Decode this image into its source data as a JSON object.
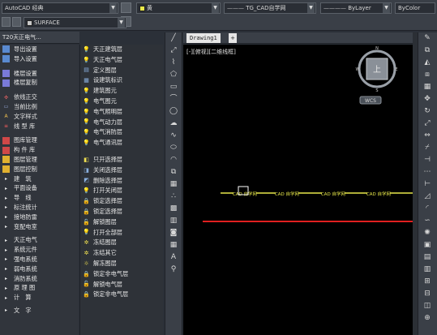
{
  "toolbar": {
    "workspace": "AutoCAD 经典",
    "layer": "黄",
    "linetype": "TG_CAD自学网",
    "lineweight": "ByLayer",
    "color": "ByColor",
    "visual_style": "SURFACE"
  },
  "panel": {
    "title": "T20天正电气..."
  },
  "menu_left": [
    {
      "label": "导出设置",
      "icon": "export-icon"
    },
    {
      "label": "导入设置",
      "icon": "import-icon"
    },
    {
      "label": "楼层设置",
      "icon": "floor-icon"
    },
    {
      "label": "楼层复制",
      "icon": "floor-copy-icon"
    },
    {
      "label": "依线正交",
      "icon": "ortho-icon"
    },
    {
      "label": "当前比例",
      "icon": "scale-icon"
    },
    {
      "label": "文字样式",
      "icon": "text-style-icon"
    },
    {
      "label": "线 型 库",
      "icon": "linetype-icon"
    },
    {
      "label": "图库管理",
      "icon": "library-icon"
    },
    {
      "label": "构 件 库",
      "icon": "component-icon"
    },
    {
      "label": "图层管理",
      "icon": "layer-manage-icon"
    },
    {
      "label": "图层控制",
      "icon": "layer-control-icon"
    },
    {
      "label": "建　筑",
      "icon": "arrow-icon"
    },
    {
      "label": "平面设备",
      "icon": "arrow-icon"
    },
    {
      "label": "导　线",
      "icon": "arrow-icon"
    },
    {
      "label": "标注统计",
      "icon": "arrow-icon"
    },
    {
      "label": "接地防雷",
      "icon": "arrow-icon"
    },
    {
      "label": "变配电室",
      "icon": "arrow-icon"
    },
    {
      "label": "天正电气",
      "icon": "arrow-icon"
    },
    {
      "label": "系统元件",
      "icon": "arrow-icon"
    },
    {
      "label": "强电系统",
      "icon": "arrow-icon"
    },
    {
      "label": "弱电系统",
      "icon": "arrow-icon"
    },
    {
      "label": "消防系统",
      "icon": "arrow-icon"
    },
    {
      "label": "原 理 图",
      "icon": "arrow-icon"
    },
    {
      "label": "计　算",
      "icon": "arrow-icon"
    },
    {
      "label": "文　字",
      "icon": "arrow-icon"
    }
  ],
  "menu_right": [
    {
      "label": "天正建筑层",
      "icon": "bulb-icon"
    },
    {
      "label": "天正电气层",
      "icon": "bulb-icon"
    },
    {
      "label": "定义图层",
      "icon": "layer-define-icon"
    },
    {
      "label": "设建筑标识",
      "icon": "layer-mark-icon"
    },
    {
      "label": "建筑图元",
      "icon": "bulb-icon"
    },
    {
      "label": "电气图元",
      "icon": "bulb-icon"
    },
    {
      "label": "电气照明层",
      "icon": "bulb-icon"
    },
    {
      "label": "电气动力层",
      "icon": "bulb-icon"
    },
    {
      "label": "电气消防层",
      "icon": "bulb-icon"
    },
    {
      "label": "电气通讯层",
      "icon": "bulb-icon"
    },
    {
      "label": "只开选择层",
      "icon": "layer-open-icon"
    },
    {
      "label": "关闭选择层",
      "icon": "layer-close-icon"
    },
    {
      "label": "删除选择层",
      "icon": "layer-delete-icon"
    },
    {
      "label": "打开关闭层",
      "icon": "layer-toggle-icon"
    },
    {
      "label": "锁定选择层",
      "icon": "lock-icon"
    },
    {
      "label": "锁定选择层",
      "icon": "lock-icon"
    },
    {
      "label": "解锁图层",
      "icon": "unlock-icon"
    },
    {
      "label": "打开全部层",
      "icon": "layer-all-icon"
    },
    {
      "label": "冻结图层",
      "icon": "freeze-icon"
    },
    {
      "label": "冻结其它",
      "icon": "freeze-icon"
    },
    {
      "label": "解冻图层",
      "icon": "thaw-icon"
    },
    {
      "label": "锁定非电气层",
      "icon": "lock-icon"
    },
    {
      "label": "解锁电气层",
      "icon": "unlock-icon"
    },
    {
      "label": "锁定非电气层",
      "icon": "lock-icon"
    }
  ],
  "drawing": {
    "tab_label": "Drawing1",
    "tab_add": "+",
    "viewport_label": "[-][俯视][二维线框]",
    "viewcube_face": "上",
    "wcs_label": "WCS",
    "wire_text": "CAD 自学网"
  },
  "colors": {
    "accent_yellow": "#e8e84a",
    "red_line": "#e02020",
    "canvas_bg": "#000000"
  }
}
